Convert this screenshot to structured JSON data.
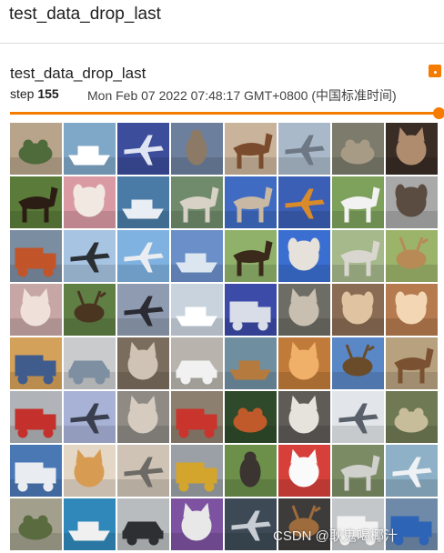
{
  "header": {
    "title": "test_data_drop_last"
  },
  "card": {
    "title": "test_data_drop_last",
    "step_label": "step",
    "step_value": "155",
    "timestamp": "Mon Feb 07 2022 07:48:17 GMT+0800 (中国标准时间)",
    "accent_color": "#f57c00",
    "step_slider_position": 1.0
  },
  "image_grid": {
    "rows": 8,
    "cols": 8,
    "cells": [
      {
        "label": "frog",
        "bg": "#b7a48a",
        "fg": "#4f6b3b"
      },
      {
        "label": "ship",
        "bg": "#7fa7c7",
        "fg": "#ffffff"
      },
      {
        "label": "airplane",
        "bg": "#3c4d9b",
        "fg": "#dfe4f2"
      },
      {
        "label": "bird",
        "bg": "#6c7f9c",
        "fg": "#8c7a66"
      },
      {
        "label": "horse",
        "bg": "#c9b39b",
        "fg": "#7a4b2c"
      },
      {
        "label": "airplane",
        "bg": "#aab9c9",
        "fg": "#6d7884"
      },
      {
        "label": "frog",
        "bg": "#7c7b6c",
        "fg": "#a89b86"
      },
      {
        "label": "cat",
        "bg": "#3a2d25",
        "fg": "#b08c6f"
      },
      {
        "label": "horse",
        "bg": "#5a7b3a",
        "fg": "#2c1d14"
      },
      {
        "label": "dog",
        "bg": "#d99aa3",
        "fg": "#f1e9e1"
      },
      {
        "label": "ship",
        "bg": "#4a7ba7",
        "fg": "#e8eef4"
      },
      {
        "label": "horse",
        "bg": "#6f8b6b",
        "fg": "#d8d1c5"
      },
      {
        "label": "horse",
        "bg": "#3f6bc2",
        "fg": "#c9b8a3"
      },
      {
        "label": "airplane",
        "bg": "#3b5fb5",
        "fg": "#d98a2b"
      },
      {
        "label": "horse",
        "bg": "#7ea15c",
        "fg": "#f2f2f2"
      },
      {
        "label": "dog",
        "bg": "#a9a9a9",
        "fg": "#5a4c40"
      },
      {
        "label": "truck",
        "bg": "#7b8da1",
        "fg": "#c2542a"
      },
      {
        "label": "airplane",
        "bg": "#a7c4e2",
        "fg": "#2a2f33"
      },
      {
        "label": "airplane",
        "bg": "#7fb2e0",
        "fg": "#e9edf1"
      },
      {
        "label": "ship",
        "bg": "#6b8fc9",
        "fg": "#dce6f0"
      },
      {
        "label": "horse",
        "bg": "#8fb16a",
        "fg": "#3b2a1c"
      },
      {
        "label": "dog",
        "bg": "#3a6fd1",
        "fg": "#e6e1da"
      },
      {
        "label": "horse",
        "bg": "#a6b98b",
        "fg": "#d9d6cf"
      },
      {
        "label": "deer",
        "bg": "#9cb36a",
        "fg": "#b88a56"
      },
      {
        "label": "cat",
        "bg": "#c6a7a6",
        "fg": "#f0e0da"
      },
      {
        "label": "deer",
        "bg": "#5f7f44",
        "fg": "#4a3521"
      },
      {
        "label": "airplane",
        "bg": "#8f9bb0",
        "fg": "#2b2b33"
      },
      {
        "label": "ship",
        "bg": "#c9d3dd",
        "fg": "#ffffff"
      },
      {
        "label": "truck",
        "bg": "#3c4aa8",
        "fg": "#d9dde8"
      },
      {
        "label": "cat",
        "bg": "#6d6d65",
        "fg": "#c9bfb0"
      },
      {
        "label": "dog",
        "bg": "#8a6c54",
        "fg": "#e0c3a0"
      },
      {
        "label": "dog",
        "bg": "#b67a4f",
        "fg": "#f3d7b4"
      },
      {
        "label": "truck",
        "bg": "#d4a15b",
        "fg": "#3f5c8c"
      },
      {
        "label": "automobile",
        "bg": "#c9cbcd",
        "fg": "#7d8fa0"
      },
      {
        "label": "cat",
        "bg": "#7a6d5e",
        "fg": "#cfc3b5"
      },
      {
        "label": "automobile",
        "bg": "#b8b4ad",
        "fg": "#f1f1f1"
      },
      {
        "label": "ship",
        "bg": "#6f8fa1",
        "fg": "#b57a3d"
      },
      {
        "label": "cat",
        "bg": "#c07a3a",
        "fg": "#f0b06a"
      },
      {
        "label": "deer",
        "bg": "#5a88c7",
        "fg": "#6a4c2b"
      },
      {
        "label": "horse",
        "bg": "#b8a17f",
        "fg": "#7a5232"
      },
      {
        "label": "truck",
        "bg": "#b0b4b8",
        "fg": "#c4302b"
      },
      {
        "label": "airplane",
        "bg": "#a8b2d6",
        "fg": "#3a3f4f"
      },
      {
        "label": "cat",
        "bg": "#8f8a84",
        "fg": "#d6cbbf"
      },
      {
        "label": "truck",
        "bg": "#8d7f6f",
        "fg": "#c9342c"
      },
      {
        "label": "frog",
        "bg": "#2f4a2a",
        "fg": "#c05a2a"
      },
      {
        "label": "cat",
        "bg": "#5f5b57",
        "fg": "#e6e2dc"
      },
      {
        "label": "airplane",
        "bg": "#e2e6ea",
        "fg": "#59606a"
      },
      {
        "label": "frog",
        "bg": "#6f7a55",
        "fg": "#c8bd9a"
      },
      {
        "label": "truck",
        "bg": "#4a78b5",
        "fg": "#e9edf1"
      },
      {
        "label": "cat",
        "bg": "#e4d7c6",
        "fg": "#d79c52"
      },
      {
        "label": "airplane",
        "bg": "#cfc3b6",
        "fg": "#6d6a66"
      },
      {
        "label": "truck",
        "bg": "#9aa0a6",
        "fg": "#d4a52c"
      },
      {
        "label": "bird",
        "bg": "#6c8f4a",
        "fg": "#3b3430"
      },
      {
        "label": "cat",
        "bg": "#d7403a",
        "fg": "#fafafa"
      },
      {
        "label": "horse",
        "bg": "#7b8c65",
        "fg": "#d0d0cd"
      },
      {
        "label": "airplane",
        "bg": "#8fb1c7",
        "fg": "#eef2f4"
      },
      {
        "label": "frog",
        "bg": "#a2a08d",
        "fg": "#5a6b3f"
      },
      {
        "label": "ship",
        "bg": "#2f88b9",
        "fg": "#f0f0f0"
      },
      {
        "label": "automobile",
        "bg": "#b9bcbe",
        "fg": "#2d2f33"
      },
      {
        "label": "cat",
        "bg": "#7d53a1",
        "fg": "#e8e8e8"
      },
      {
        "label": "airplane",
        "bg": "#3d4a56",
        "fg": "#c7cdd2"
      },
      {
        "label": "deer",
        "bg": "#3e3c3a",
        "fg": "#9d6b3c"
      },
      {
        "label": "truck",
        "bg": "#c3c7ca",
        "fg": "#f2f2f2"
      },
      {
        "label": "truck",
        "bg": "#6f8aa9",
        "fg": "#2e64b5"
      }
    ]
  },
  "watermark": {
    "text": "CSDN @耿鬼喝椰汁"
  }
}
